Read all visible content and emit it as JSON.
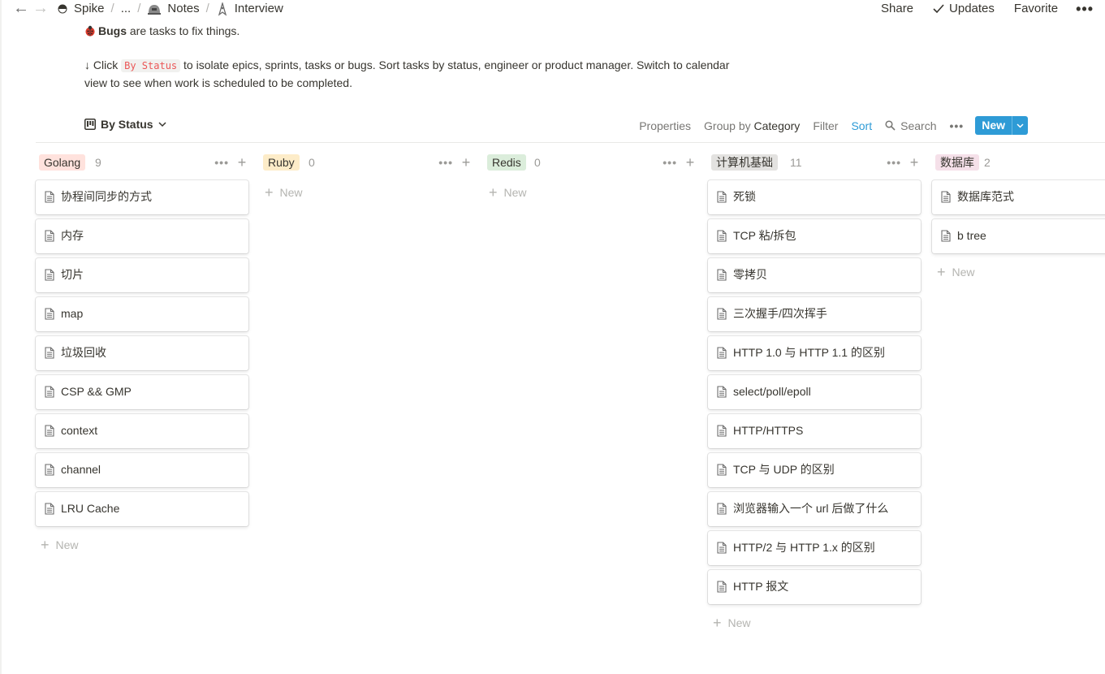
{
  "topbar": {
    "breadcrumbs": [
      {
        "label": "Spike",
        "icon": "avatar-icon"
      },
      {
        "label": "...",
        "icon": ""
      },
      {
        "label": "Notes",
        "icon": "helmet-icon"
      },
      {
        "label": "Interview",
        "icon": "rocket-icon"
      }
    ],
    "share": "Share",
    "updates": "Updates",
    "favorite": "Favorite"
  },
  "description": {
    "bugs_bold": "Bugs",
    "bugs_rest": " are tasks to fix things.",
    "line2_prefix": "↓ Click ",
    "line2_code": "By Status",
    "line2_rest": " to isolate epics, sprints, tasks or bugs. Sort tasks by status, engineer or product manager. Switch to calendar view to see when work is scheduled to be completed."
  },
  "view": {
    "name": "By Status",
    "properties": "Properties",
    "group_prefix": "Group by ",
    "group_value": "Category",
    "filter": "Filter",
    "sort": "Sort",
    "search": "Search",
    "new": "New"
  },
  "board": {
    "new_label": "New",
    "columns": [
      {
        "name": "Golang",
        "count": "9",
        "color": "#ffe2dd",
        "items": [
          "协程间同步的方式",
          "内存",
          "切片",
          "map",
          "垃圾回收",
          "CSP && GMP",
          "context",
          "channel",
          "LRU Cache"
        ]
      },
      {
        "name": "Ruby",
        "count": "0",
        "color": "#fdecc8",
        "items": []
      },
      {
        "name": "Redis",
        "count": "0",
        "color": "#dbeddb",
        "items": []
      },
      {
        "name": "计算机基础",
        "count": "11",
        "color": "#e3e2e0",
        "items": [
          "死锁",
          "TCP 粘/拆包",
          "零拷贝",
          "三次握手/四次挥手",
          "HTTP 1.0 与 HTTP 1.1 的区别",
          "select/poll/epoll",
          "HTTP/HTTPS",
          "TCP 与 UDP 的区别",
          "浏览器输入一个 url 后做了什么",
          "HTTP/2 与 HTTP 1.x 的区别",
          "HTTP 报文"
        ]
      },
      {
        "name": "数据库",
        "count": "2",
        "color": "#f5e0e9",
        "items": [
          "数据库范式",
          "b tree"
        ]
      }
    ]
  }
}
